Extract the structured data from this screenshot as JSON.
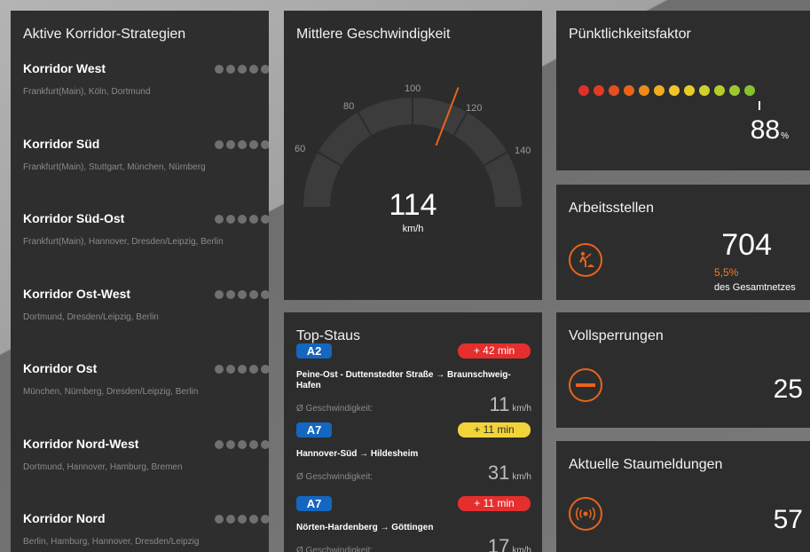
{
  "strategies": {
    "title": "Aktive Korridor-Strategien",
    "items": [
      {
        "name": "Korridor West",
        "cities": "Frankfurt(Main), Köln, Dortmund"
      },
      {
        "name": "Korridor Süd",
        "cities": "Frankfurt(Main), Stuttgart, München, Nürnberg"
      },
      {
        "name": "Korridor Süd-Ost",
        "cities": "Frankfurt(Main), Hannover, Dresden/Leipzig, Berlin"
      },
      {
        "name": "Korridor Ost-West",
        "cities": "Dortmund, Dresden/Leipzig, Berlin"
      },
      {
        "name": "Korridor Ost",
        "cities": "München, Nürnberg, Dresden/Leipzig, Berlin"
      },
      {
        "name": "Korridor Nord-West",
        "cities": "Dortmund, Hannover, Hamburg, Bremen"
      },
      {
        "name": "Korridor Nord",
        "cities": "Berlin, Hamburg, Hannover, Dresden/Leipzig"
      }
    ]
  },
  "speed": {
    "title": "Mittlere Geschwindigkeit",
    "value": "114",
    "unit": "km/h",
    "ticks": [
      "60",
      "80",
      "100",
      "120",
      "140"
    ],
    "needle_value": 114,
    "needle_color": "#e8641b"
  },
  "punctuality": {
    "title": "Pünktlichkeitsfaktor",
    "value": "88",
    "unit": "%",
    "dot_colors": [
      "#e0302a",
      "#e23b25",
      "#e5501f",
      "#e8641b",
      "#ec8a1c",
      "#f0ad20",
      "#f2c425",
      "#e6cc28",
      "#cfd02a",
      "#b5cc2c",
      "#9cc72e",
      "#86c232"
    ],
    "level": 0.88
  },
  "worksites": {
    "title": "Arbeitsstellen",
    "value": "704",
    "percent": "5,5%",
    "caption": "des Gesamtnetzes",
    "icon": "roadwork-icon"
  },
  "closures": {
    "title": "Vollsperrungen",
    "value": "25",
    "icon": "no-entry-icon"
  },
  "jams": {
    "title": "Aktuelle Staumeldungen",
    "value": "57",
    "icon": "broadcast-icon"
  },
  "top_jams": {
    "title": "Top-Staus",
    "speed_label": "Ø Geschwindigkeit:",
    "speed_unit": "km/h",
    "items": [
      {
        "road": "A2",
        "delay": "+ 42  min",
        "severity": "red",
        "route": "Peine-Ost - Duttenstedter Straße → Braunschweig-Hafen",
        "speed": "11"
      },
      {
        "road": "A7",
        "delay": "+ 11  min",
        "severity": "yellow",
        "route": "Hannover-Süd → Hildesheim",
        "speed": "31"
      },
      {
        "road": "A7",
        "delay": "+ 11  min",
        "severity": "red",
        "route": "Nörten-Hardenberg → Göttingen",
        "speed": "17"
      }
    ]
  }
}
